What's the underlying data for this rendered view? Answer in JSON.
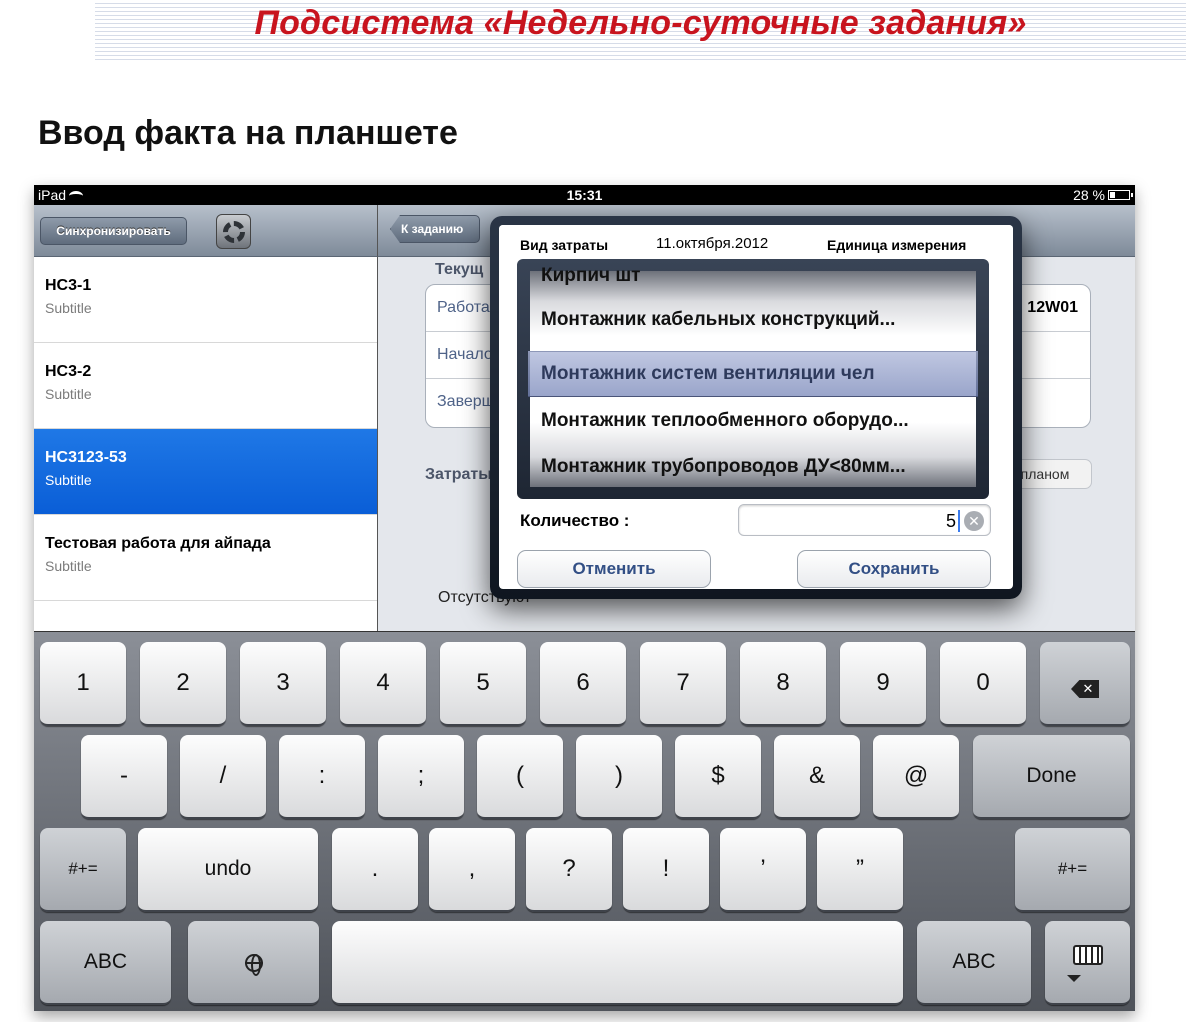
{
  "slide": {
    "title": "Подсистема «Недельно-суточные задания»",
    "subtitle": "Ввод факта на планшете"
  },
  "statusbar": {
    "device": "iPad",
    "time": "15:31",
    "battery": "28 %",
    "battery_level": 0.28
  },
  "left_pane": {
    "sync_button": "Синхронизировать",
    "settings_icon": "gear-icon",
    "items": [
      {
        "title": "НС3-1",
        "subtitle": "Subtitle"
      },
      {
        "title": "НС3-2",
        "subtitle": "Subtitle"
      },
      {
        "title": "НС3123-53",
        "subtitle": "Subtitle",
        "selected": true
      },
      {
        "title": "Тестовая работа для айпада",
        "subtitle": "Subtitle"
      }
    ]
  },
  "right_pane": {
    "back_button": "К заданию",
    "section_label": "Текущ",
    "rows": [
      {
        "label": "Работа",
        "value": "12W01"
      },
      {
        "label": "Начало",
        "value": ""
      },
      {
        "label": "Завершение",
        "value": ""
      }
    ],
    "costs_label": "Затраты",
    "plan_button": "планом",
    "absent_text": "Отсутствуют"
  },
  "popover": {
    "header": {
      "cost_type": "Вид затраты",
      "date": "11.октября.2012",
      "unit": "Единица измерения"
    },
    "picker": [
      "Кирпич  шт",
      "Монтажник кабельных конструкций...",
      "Монтажник систем вентиляции  чел",
      "Монтажник теплообменного оборудо...",
      "Монтажник трубопроводов ДУ<80мм..."
    ],
    "quantity_label": "Количество :",
    "quantity_value": "5",
    "cancel_button": "Отменить",
    "save_button": "Сохранить"
  },
  "keyboard": {
    "row1": [
      "1",
      "2",
      "3",
      "4",
      "5",
      "6",
      "7",
      "8",
      "9",
      "0"
    ],
    "row2": [
      "-",
      "/",
      ":",
      ";",
      "(",
      ")",
      "$",
      "&",
      "@"
    ],
    "done": "Done",
    "row3_left": "#+=",
    "undo": "undo",
    "row3": [
      ".",
      ",",
      "?",
      "!",
      "’",
      "”"
    ],
    "row3_right": "#+=",
    "abc_left": "ABC",
    "abc_right": "ABC"
  }
}
